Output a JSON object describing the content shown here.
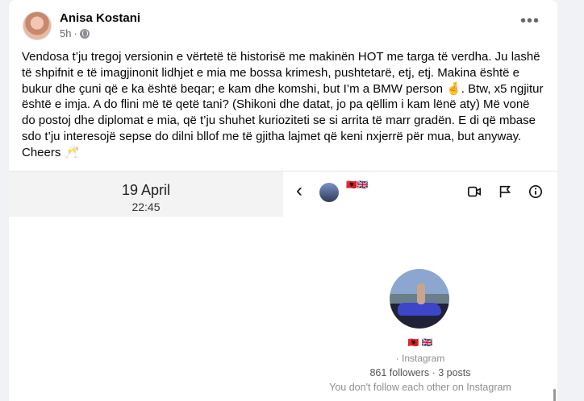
{
  "post": {
    "author": "Anisa Kostani",
    "time": "5h",
    "privacy_icon": "globe-icon",
    "more_icon": "more-options-icon",
    "text": "Vendosa t’ju tregoj versionin e vërtetë të historisë me makinën HOT me targa të verdha. Ju lashë të shpifnit e të imagjinonit lidhjet e mia me bossa krimesh, pushtetarë, etj, etj. Makina është e bukur dhe çuni që e ka është beqar; e kam dhe komshi, but I’m a BMW person 🤞. Btw, x5 ngjitur është e imja. A do flini më të qetë tani? (Shikoni dhe datat, jo pa qëllim i kam lënë aty) Më vonë do postoj dhe diplomat e mia, që t’ju shuhet kurioziteti se si arrita të marr gradën. E di që mbase sdo t’ju interesojë sepse do dilni bllof me të gjitha lajmet që keni nxjerrë për mua, but anyway. Cheers 🥂"
  },
  "media": {
    "left": {
      "date": "19 April",
      "time": "22:45"
    },
    "right": {
      "header_flags": "🇦🇱🇬🇧",
      "profile_flags": "🇦🇱 🇬🇧",
      "source": "· Instagram",
      "stats": "861 followers · 3 posts",
      "follow_status": "You don't follow each other on Instagram",
      "icons": [
        "back-icon",
        "video-call-icon",
        "flag-icon",
        "info-icon"
      ]
    }
  }
}
